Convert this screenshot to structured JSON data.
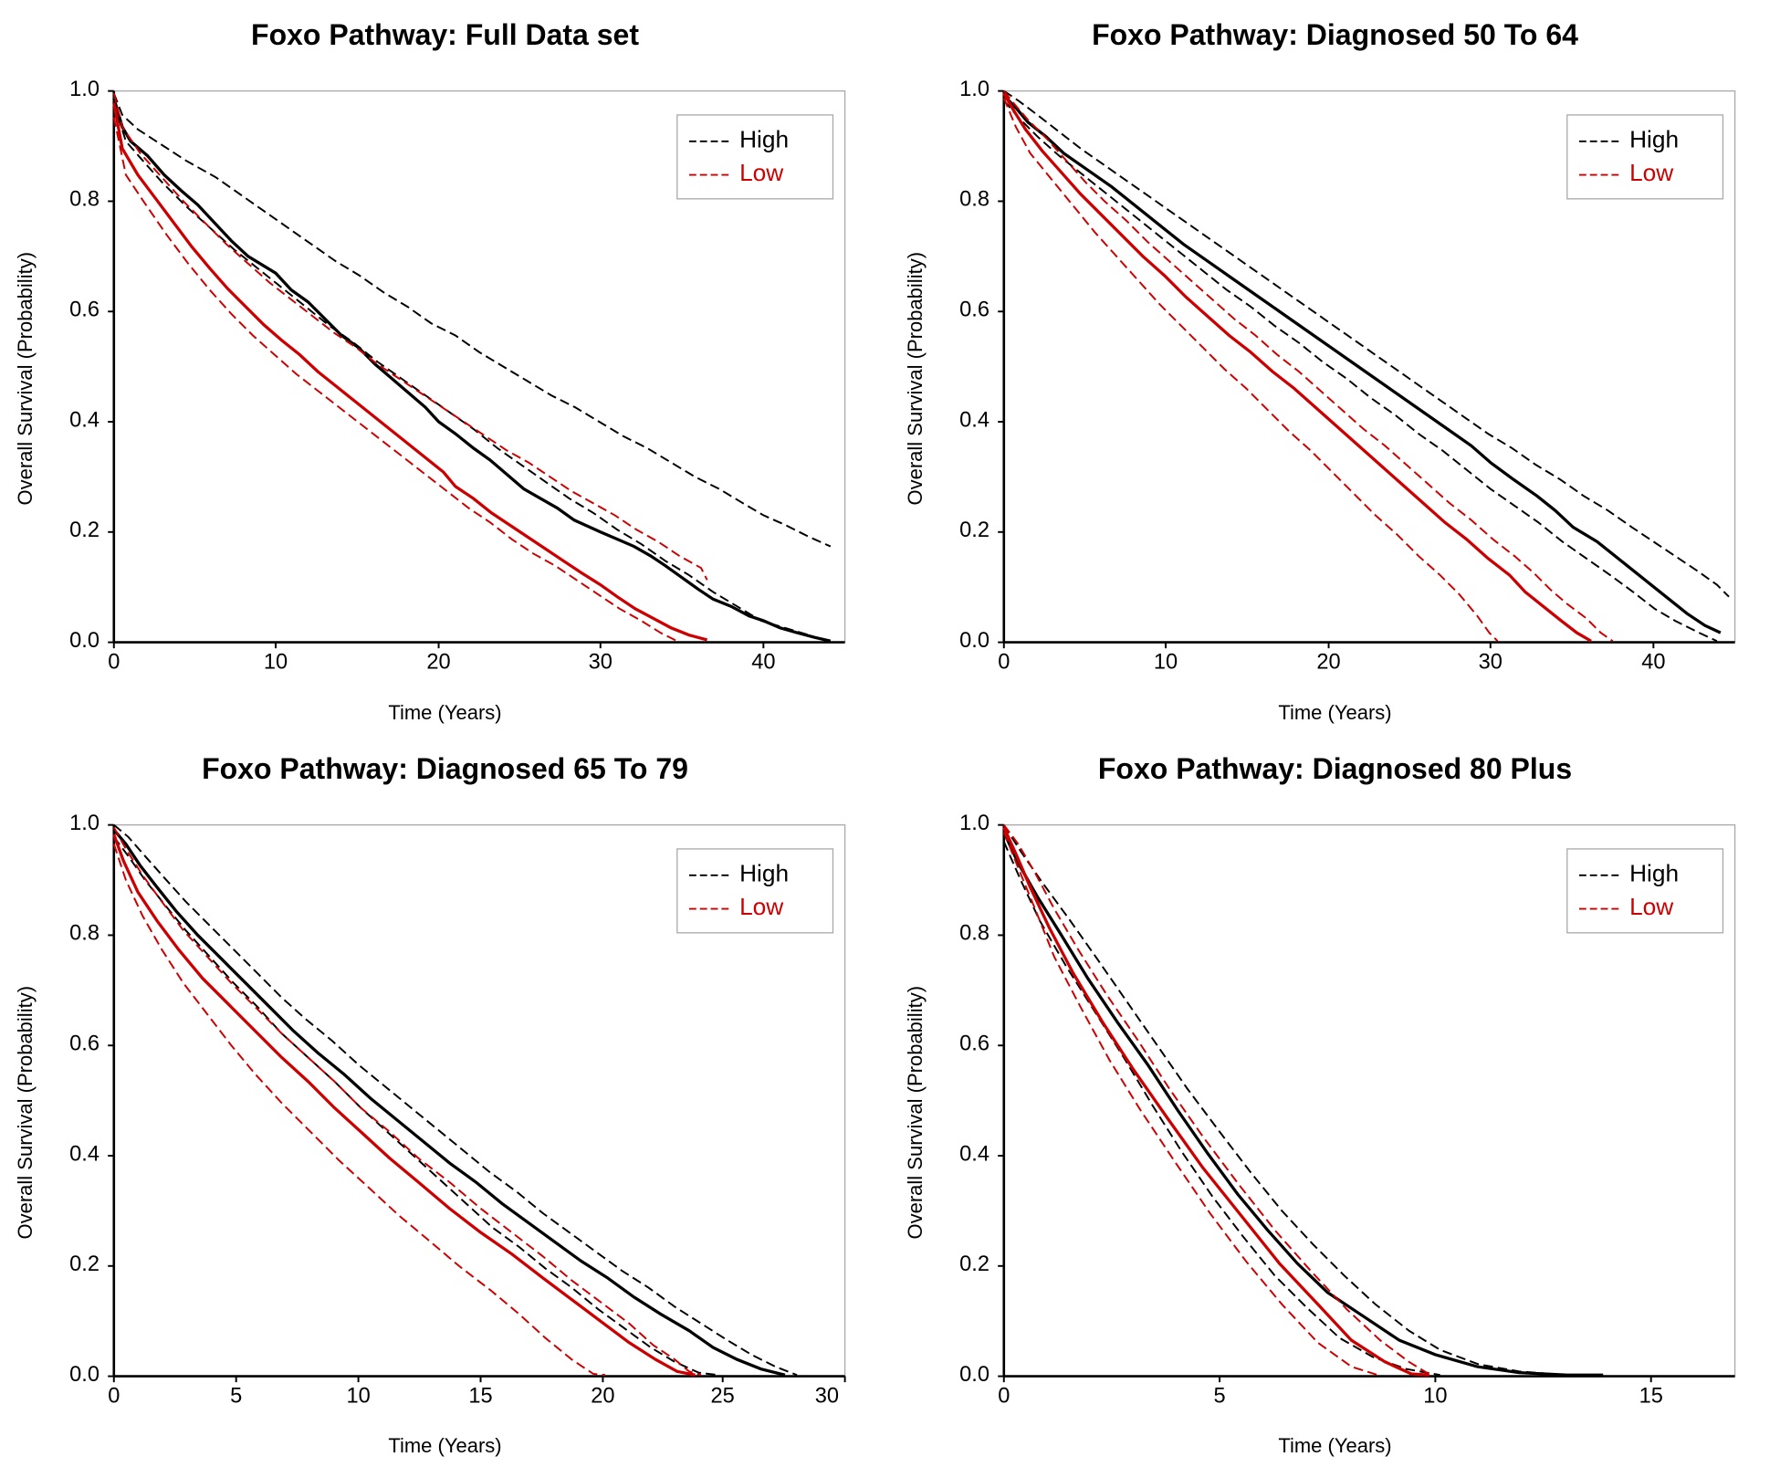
{
  "charts": [
    {
      "id": "chart1",
      "title": "Foxo Pathway: Full Data set",
      "xLabel": "Time (Years)",
      "yLabel": "Overall Survival (Probability)",
      "xMax": 45,
      "yMax": 1.0,
      "legend": [
        {
          "label": "High",
          "color": "#000000",
          "dash": "8,4"
        },
        {
          "label": "Low",
          "color": "#cc0000",
          "dash": "8,4"
        }
      ]
    },
    {
      "id": "chart2",
      "title": "Foxo Pathway: Diagnosed 50 To 64",
      "xLabel": "Time (Years)",
      "yLabel": "Overall Survival (Probability)",
      "xMax": 45,
      "yMax": 1.0,
      "legend": [
        {
          "label": "High",
          "color": "#000000",
          "dash": "8,4"
        },
        {
          "label": "Low",
          "color": "#cc0000",
          "dash": "8,4"
        }
      ]
    },
    {
      "id": "chart3",
      "title": "Foxo Pathway: Diagnosed 65 To 79",
      "xLabel": "Time (Years)",
      "yLabel": "Overall Survival (Probability)",
      "xMax": 30,
      "yMax": 1.0,
      "legend": [
        {
          "label": "High",
          "color": "#000000",
          "dash": "8,4"
        },
        {
          "label": "Low",
          "color": "#cc0000",
          "dash": "8,4"
        }
      ]
    },
    {
      "id": "chart4",
      "title": "Foxo Pathway: Diagnosed 80 Plus",
      "xLabel": "Time (Years)",
      "yLabel": "Overall Survival (Probability)",
      "xMax": 17,
      "yMax": 1.0,
      "legend": [
        {
          "label": "High",
          "color": "#000000",
          "dash": "8,4"
        },
        {
          "label": "Low",
          "color": "#cc0000",
          "dash": "8,4"
        }
      ]
    }
  ]
}
